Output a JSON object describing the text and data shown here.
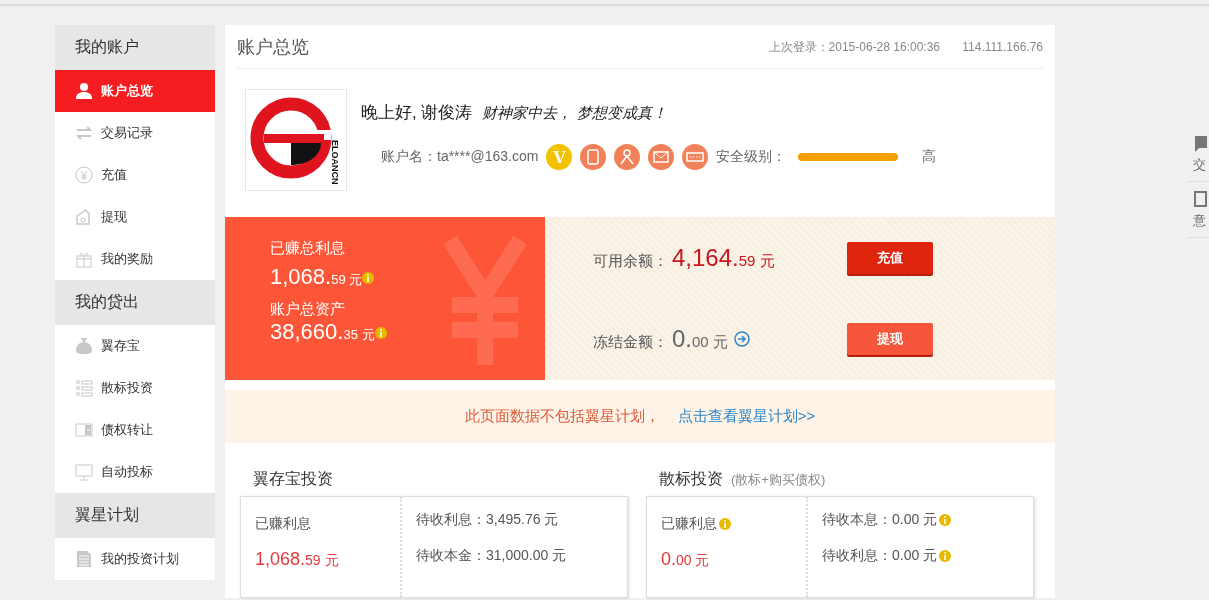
{
  "sidebar": {
    "groups": [
      {
        "title": "我的账户",
        "items": [
          {
            "label": "账户总览",
            "selected": true
          },
          {
            "label": "交易记录",
            "selected": false
          },
          {
            "label": "充值",
            "selected": false
          },
          {
            "label": "提现",
            "selected": false
          },
          {
            "label": "我的奖励",
            "selected": false
          }
        ]
      },
      {
        "title": "我的贷出",
        "items": [
          {
            "label": "翼存宝",
            "selected": false
          },
          {
            "label": "散标投资",
            "selected": false
          },
          {
            "label": "债权转让",
            "selected": false
          },
          {
            "label": "自动投标",
            "selected": false
          }
        ]
      },
      {
        "title": "翼星计划",
        "items": [
          {
            "label": "我的投资计划",
            "selected": false
          }
        ]
      }
    ]
  },
  "header": {
    "title": "账户总览",
    "last_login": "上次登录：2015-06-28 16:00:36",
    "ip": "114.111.166.76"
  },
  "profile": {
    "logo_text": "ELOANCN",
    "greeting": "晚上好, 谢俊涛",
    "slogan": "财神家中去， 梦想变成真！",
    "account_label": "账户名：",
    "account": "ta****@163.com",
    "badges": [
      {
        "kind": "vip",
        "text": "V"
      },
      {
        "kind": "phone"
      },
      {
        "kind": "person"
      },
      {
        "kind": "mail"
      },
      {
        "kind": "card"
      }
    ],
    "security_label": "安全级别：",
    "security": {
      "level": 1
    },
    "security_text": "高"
  },
  "summary": {
    "earned_label": "已赚总利息",
    "earned_int": "1,068.",
    "earned_dec": "59",
    "earned_unit": "元",
    "assets_label": "账户总资产",
    "assets_int": "38,660.",
    "assets_dec": "35",
    "assets_unit": "元",
    "available_label": "可用余额：",
    "available_int": "4,164.",
    "available_dec": "59",
    "available_unit": "元",
    "frozen_label": "冻结金额：",
    "frozen_int": "0.",
    "frozen_dec": "00",
    "frozen_unit": "元",
    "buttons": [
      {
        "label": "充值",
        "kind": "primary"
      },
      {
        "label": "提现",
        "kind": "secondary"
      }
    ]
  },
  "notice": {
    "text": "此页面数据不包括翼星计划，",
    "link": "点击查看翼星计划>>"
  },
  "investments": [
    {
      "title": "翼存宝投资",
      "earned_label": "已赚利息",
      "earned_info": false,
      "earned_int": "1,068.",
      "earned_dec": "59",
      "earned_unit": "元",
      "rows": [
        {
          "text": "待收利息：3,495.76 元",
          "info": false
        },
        {
          "text": "待收本金：31,000.00 元",
          "info": false
        }
      ]
    },
    {
      "title": "散标投资",
      "subtitle": "(散标+购买债权)",
      "earned_label": "已赚利息",
      "earned_info": true,
      "earned_int": "0.",
      "earned_dec": "00",
      "earned_unit": "元",
      "rows": [
        {
          "text": "待收本息：0.00 元",
          "info": true
        },
        {
          "text": "待收利息：0.00 元",
          "info": true
        }
      ]
    }
  ],
  "side_tabs": [
    {
      "label": "交"
    },
    {
      "label": "意"
    }
  ]
}
